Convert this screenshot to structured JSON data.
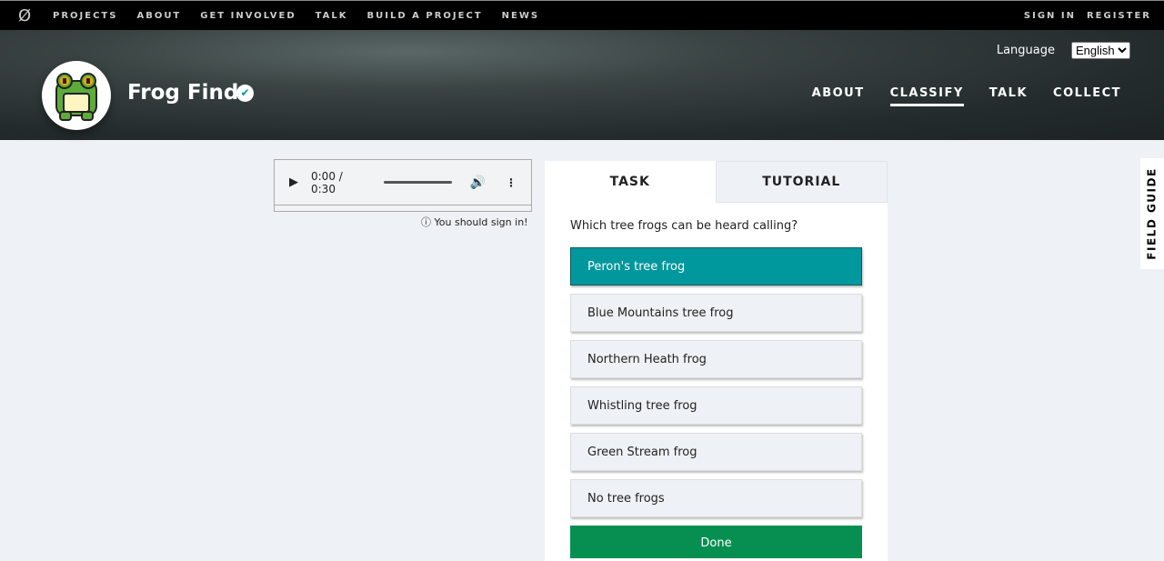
{
  "topnav": {
    "items": [
      "PROJECTS",
      "ABOUT",
      "GET INVOLVED",
      "TALK",
      "BUILD A PROJECT",
      "NEWS"
    ],
    "sign_in": "SIGN IN",
    "register": "REGISTER"
  },
  "project": {
    "title": "Frog Find",
    "language_label": "Language",
    "language": "English",
    "nav": [
      "ABOUT",
      "CLASSIFY",
      "TALK",
      "COLLECT"
    ]
  },
  "audio": {
    "time": "0:00 / 0:30",
    "signin_notice": "You should sign in!"
  },
  "task": {
    "tabs": [
      "TASK",
      "TUTORIAL"
    ],
    "question": "Which tree frogs can be heard calling?",
    "options": [
      "Peron's tree frog",
      "Blue Mountains tree frog",
      "Northern Heath frog",
      "Whistling tree frog",
      "Green Stream frog",
      "No tree frogs"
    ],
    "selected": 0,
    "done": "Done"
  },
  "field_guide": "FIELD GUIDE"
}
